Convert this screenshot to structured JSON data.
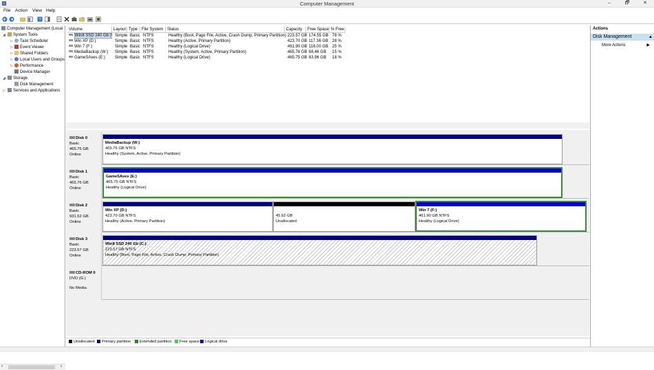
{
  "window": {
    "title": "Computer Management",
    "minimize": "–",
    "maximize": "🗗",
    "close": "✕"
  },
  "menu": [
    "File",
    "Action",
    "View",
    "Help"
  ],
  "toolbar": [
    "back-icon",
    "forward-icon",
    "up-folder-icon",
    "console-icon",
    "help-icon",
    "panel-icon",
    "delete-icon",
    "properties-icon",
    "folder-open-icon",
    "export-icon",
    "view-icon"
  ],
  "tree": {
    "root": "Computer Management (Local",
    "system_tools": "System Tools",
    "task_scheduler": "Task Scheduler",
    "event_viewer": "Event Viewer",
    "shared_folders": "Shared Folders",
    "local_users": "Local Users and Groups",
    "performance": "Performance",
    "device_manager": "Device Manager",
    "storage": "Storage",
    "disk_management": "Disk Management",
    "services": "Services and Applications"
  },
  "volumes": {
    "headers": [
      "Volume",
      "Layout",
      "Type",
      "File System",
      "Status",
      "Capacity",
      "Free Space",
      "% Free"
    ],
    "rows": [
      [
        "Win8 SSD 240 Gb (C:)",
        "Simple",
        "Basic",
        "NTFS",
        "Healthy (Boot, Page File, Active, Crash Dump, Primary Partition)",
        "223.57 GB",
        "174.55 GB",
        "78 %"
      ],
      [
        "Win XP (D:)",
        "Simple",
        "Basic",
        "NTFS",
        "Healthy (Active, Primary Partition)",
        "423.70 GB",
        "117.36 GB",
        "28 %"
      ],
      [
        "Win 7 (F:)",
        "Simple",
        "Basic",
        "NTFS",
        "Healthy (Logical Drive)",
        "461.90 GB",
        "116.00 GB",
        "25 %"
      ],
      [
        "MediaBackup (W:)",
        "Simple",
        "Basic",
        "NTFS",
        "Healthy (System, Active, Primary Partition)",
        "465.76 GB",
        "68.46 GB",
        "15 %"
      ],
      [
        "GameSAves (E:)",
        "Simple",
        "Basic",
        "NTFS",
        "Healthy (Logical Drive)",
        "465.75 GB",
        "83.96 GB",
        "18 %"
      ]
    ]
  },
  "disks": {
    "d0": {
      "name": "Disk 0",
      "type": "Basic",
      "size": "465.76 GB",
      "status": "Online",
      "p1": {
        "name": "MediaBackup  (W:)",
        "size": "465.76 GB NTFS",
        "status": "Healthy (System, Active, Primary Partition)"
      }
    },
    "d1": {
      "name": "Disk 1",
      "type": "Basic",
      "size": "465.76 GB",
      "status": "Online",
      "p1": {
        "name": "GameSAves  (E:)",
        "size": "465.75 GB NTFS",
        "status": "Healthy (Logical Drive)"
      }
    },
    "d2": {
      "name": "Disk 2",
      "type": "Basic",
      "size": "931.52 GB",
      "status": "Online",
      "p1": {
        "name": "Win XP  (D:)",
        "size": "423.70 GB NTFS",
        "status": "Healthy (Active, Primary Partition)"
      },
      "p2": {
        "size": "45.92 GB",
        "status": "Unallocated"
      },
      "p3": {
        "name": "Win 7  (F:)",
        "size": "461.90 GB NTFS",
        "status": "Healthy (Logical Drive)"
      }
    },
    "d3": {
      "name": "Disk 3",
      "type": "Basic",
      "size": "223.57 GB",
      "status": "Online",
      "p1": {
        "name": "Win8 SSD 240 Gb  (C:)",
        "size": "223.57 GB NTFS",
        "status": "Healthy (Boot, Page File, Active, Crash Dump, Primary Partition)"
      }
    },
    "cd": {
      "name": "CD-ROM 0",
      "type": "DVD (G:)",
      "status": "No Media"
    }
  },
  "legend": [
    {
      "label": "Unallocated",
      "color": "#000000"
    },
    {
      "label": "Primary partition",
      "color": "#000080"
    },
    {
      "label": "Extended partition",
      "color": "#1e8a1e"
    },
    {
      "label": "Free space",
      "color": "#33dd33"
    },
    {
      "label": "Logical drive",
      "color": "#0000cc"
    }
  ],
  "actions": {
    "header": "Actions",
    "section": "Disk Management",
    "more": "More Actions"
  }
}
